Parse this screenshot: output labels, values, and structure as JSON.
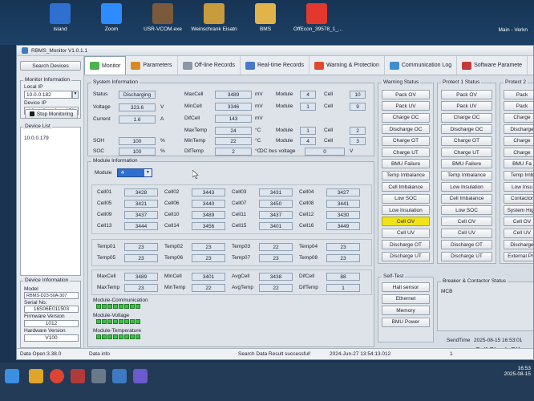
{
  "desktop": {
    "icons": [
      {
        "name": "island",
        "label": "Island",
        "color": "#2f6fd0"
      },
      {
        "name": "zoom",
        "label": "Zoom",
        "color": "#2d8cff"
      },
      {
        "name": "usr-vcom",
        "label": "USR-VCOM.exe",
        "color": "#7a5a3a"
      },
      {
        "name": "weinschrank",
        "label": "Weinschrank Eisatn",
        "color": "#c89b3c"
      },
      {
        "name": "bms",
        "label": "BMS",
        "color": "#e0b44a"
      },
      {
        "name": "offecon",
        "label": "OffEcon_39578_1_...",
        "color": "#e2382d"
      }
    ],
    "right_label": "Main - Verkn"
  },
  "window": {
    "title": "RBMS_Monitor V1.0.1.1"
  },
  "left": {
    "search_devices": "Search Devices",
    "monitor_info_title": "Monitor Information",
    "local_ip_label": "Local IP",
    "local_ip": "10.0.0.182",
    "device_ip_label": "Device IP",
    "device_ip": [
      "10",
      "0",
      "0",
      "179"
    ],
    "stop_monitoring": "Stop Monitoring",
    "device_list_title": "Device List",
    "device_list": [
      "10.0.0.179"
    ],
    "device_info_title": "Device Information",
    "model_label": "Model",
    "model": "RBMS-D23-50A-307",
    "serial_label": "Serial No.",
    "serial": "16S06E011503",
    "fw_label": "Firmware Version",
    "fw": "1012",
    "hw_label": "Hardware Version",
    "hw": "V100"
  },
  "tabs": [
    {
      "label": "Monitor",
      "color": "#4bb34b",
      "active": true
    },
    {
      "label": "Parameters",
      "color": "#d88a22"
    },
    {
      "label": "Off-line Records",
      "color": "#8a97a6"
    },
    {
      "label": "Real-time Records",
      "color": "#4a79c9"
    },
    {
      "label": "Warning & Protection",
      "color": "#e04a2a"
    },
    {
      "label": "Communication Log",
      "color": "#3f8fd0"
    },
    {
      "label": "Software Paramete",
      "color": "#c23a3a"
    }
  ],
  "system": {
    "title": "System Information",
    "status_label": "Status",
    "status": "Discharging",
    "voltage_label": "Voltage",
    "voltage": "323.6",
    "voltage_unit": "V",
    "current_label": "Current",
    "current": "1.6",
    "current_unit": "A",
    "soh_label": "SOH",
    "soh": "100",
    "soh_unit": "%",
    "soc_label": "SOC",
    "soc": "100",
    "soc_unit": "%",
    "maxcell_label": "MaxCell",
    "maxcell": "3489",
    "maxcell_unit": "mV",
    "mincell_label": "MinCell",
    "mincell": "3346",
    "mincell_unit": "mV",
    "difcell_label": "DifCell",
    "difcell": "143",
    "difcell_unit": "mV",
    "maxtemp_label": "MaxTemp",
    "maxtemp": "24",
    "maxtemp_unit": "°C",
    "mintemp_label": "MinTemp",
    "mintemp": "22",
    "mintemp_unit": "°C",
    "diftemp_label": "DifTemp",
    "diftemp": "2",
    "diftemp_unit": "°C",
    "module_label": "Module",
    "cell_label": "Cell",
    "max_module": "4",
    "max_cell": "10",
    "min_module": "1",
    "min_cell": "9",
    "maxt_module": "1",
    "maxt_cell": "2",
    "mint_module": "4",
    "mint_cell": "3",
    "dcbus_label": "DC bus voltage",
    "dcbus": "0",
    "dcbus_unit": "V"
  },
  "module": {
    "title": "Module Information",
    "module_label": "Module",
    "module_value": "4",
    "cells": [
      {
        "label": "Cell01",
        "value": "3428"
      },
      {
        "label": "Cell02",
        "value": "3443"
      },
      {
        "label": "Cell03",
        "value": "3431"
      },
      {
        "label": "Cell04",
        "value": "3427"
      },
      {
        "label": "Cell05",
        "value": "3421"
      },
      {
        "label": "Cell06",
        "value": "3440"
      },
      {
        "label": "Cell07",
        "value": "3450"
      },
      {
        "label": "Cell08",
        "value": "3441"
      },
      {
        "label": "Cell09",
        "value": "3437"
      },
      {
        "label": "Cell10",
        "value": "3489"
      },
      {
        "label": "Cell11",
        "value": "3437"
      },
      {
        "label": "Cell12",
        "value": "3430"
      },
      {
        "label": "Cell13",
        "value": "3444"
      },
      {
        "label": "Cell14",
        "value": "3456"
      },
      {
        "label": "Cell15",
        "value": "3401"
      },
      {
        "label": "Cell16",
        "value": "3449"
      }
    ],
    "temps": [
      {
        "label": "Temp01",
        "value": "23"
      },
      {
        "label": "Temp02",
        "value": "23"
      },
      {
        "label": "Temp03",
        "value": "22"
      },
      {
        "label": "Temp04",
        "value": "23"
      },
      {
        "label": "Temp05",
        "value": "23"
      },
      {
        "label": "Temp06",
        "value": "23"
      },
      {
        "label": "Temp07",
        "value": "23"
      },
      {
        "label": "Temp08",
        "value": "23"
      }
    ],
    "stats": [
      {
        "label": "MaxCell",
        "value": "3489"
      },
      {
        "label": "MinCell",
        "value": "3401"
      },
      {
        "label": "AvgCell",
        "value": "3438"
      },
      {
        "label": "DifCell",
        "value": "88"
      },
      {
        "label": "MaxTemp",
        "value": "23"
      },
      {
        "label": "MinTemp",
        "value": "22"
      },
      {
        "label": "AvgTemp",
        "value": "22"
      },
      {
        "label": "DifTemp",
        "value": "1"
      }
    ],
    "comm_label": "Module-Communication",
    "voltage_label": "Module-Voltage",
    "temp_label": "Module-Temperature"
  },
  "warning": {
    "title": "Warning Status",
    "items": [
      "Pack OV",
      "Pack UV",
      "Charge OC",
      "Discharge OC",
      "Charge OT",
      "Charge UT",
      "BMU Failure",
      "Temp Imbalance",
      "Cell Imbalance",
      "Low SOC",
      "Low Insulation",
      "Cell OV",
      "Cell UV",
      "Discharge OT",
      "Discharge UT"
    ],
    "active": [
      "Cell OV"
    ],
    "active_color": "#f0e31a"
  },
  "protect1": {
    "title": "Protect 1 Status",
    "items": [
      "Pack OV",
      "Pack UV",
      "Charge OC",
      "Discharge OC",
      "Charge OT",
      "Charge UT",
      "BMU Failure",
      "Temp Imbalance",
      "Low Insulation",
      "Cell Imbalance",
      "Low SOC",
      "Cell OV",
      "Cell UV",
      "Discharge OT",
      "Discharge UT"
    ]
  },
  "protect2": {
    "title": "Protect 2",
    "items": [
      "Pack",
      "Pack",
      "Charge",
      "Discharge",
      "Charge",
      "Charge",
      "BMU Fa",
      "Temp Imb",
      "Low Insu",
      "Contactor",
      "System High",
      "Cell OV",
      "Cell UV",
      "Discharge",
      "External Pro"
    ]
  },
  "selftest": {
    "title": "Self-Test",
    "items": [
      "Hall sensor",
      "Ethernet",
      "Memory",
      "BMU Power"
    ]
  },
  "breaker": {
    "title": "Breaker & Contactor Status",
    "mcb_label": "MCB",
    "send_time_label": "SendTime",
    "send_time": "2025-08-15 16:53:01",
    "self_check": "Self Check OK"
  },
  "statusbar": {
    "data_open": "Data Open:3.38.0",
    "info": "Data info",
    "message": "Search Data Result successful!",
    "timestamp": "2024-Jun-27 13:54:13.012",
    "right": "1"
  },
  "taskbar": {
    "date": "2025-08-15",
    "time": "16:53"
  }
}
